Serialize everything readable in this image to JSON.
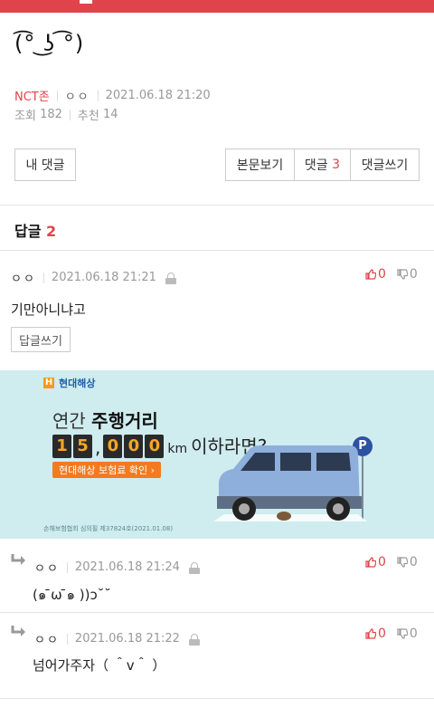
{
  "post": {
    "title": "(͡° ͜ʖ ͡°)",
    "board": "NCT존",
    "author": "ㅇㅇ",
    "datetime": "2021.06.18 21:20",
    "views_label": "조회",
    "views": "182",
    "recommend_label": "추천",
    "recommend": "14"
  },
  "actions": {
    "my_comments": "내 댓글",
    "view_post": "본문보기",
    "comments_label": "댓글",
    "comments_count": "3",
    "write_comment": "댓글쓰기"
  },
  "replies": {
    "label": "답글",
    "count": "2"
  },
  "comments": [
    {
      "author": "ㅇㅇ",
      "datetime": "2021.06.18 21:21",
      "up": "0",
      "down": "0",
      "body": "기만아니냐고",
      "reply_label": "답글쓰기"
    },
    {
      "author": "ㅇㅇ",
      "datetime": "2021.06.18 21:24",
      "up": "0",
      "down": "0",
      "body": "(๑ ̄ω ̄๑ ))ɔ˘˘"
    },
    {
      "author": "ㅇㅇ",
      "datetime": "2021.06.18 21:22",
      "up": "0",
      "down": "0",
      "body": "넘어가주자（ ＾v＾ ）"
    }
  ],
  "ad": {
    "brand": "현대해상",
    "line1_a": "연간",
    "line1_b": "주행거리",
    "digits_a": [
      "1",
      "5"
    ],
    "digits_b": [
      "0",
      "0",
      "0"
    ],
    "unit": "km",
    "line2_tail": "이하라면?",
    "cta": "현대해상 보험료 확인 ›",
    "note": "손해보험협회 심의필 제37824호(2021.01.08)",
    "parking": "P"
  },
  "colors": {
    "accent": "#e0444a",
    "ad_bg": "#cfecef",
    "cta": "#f47a20"
  }
}
